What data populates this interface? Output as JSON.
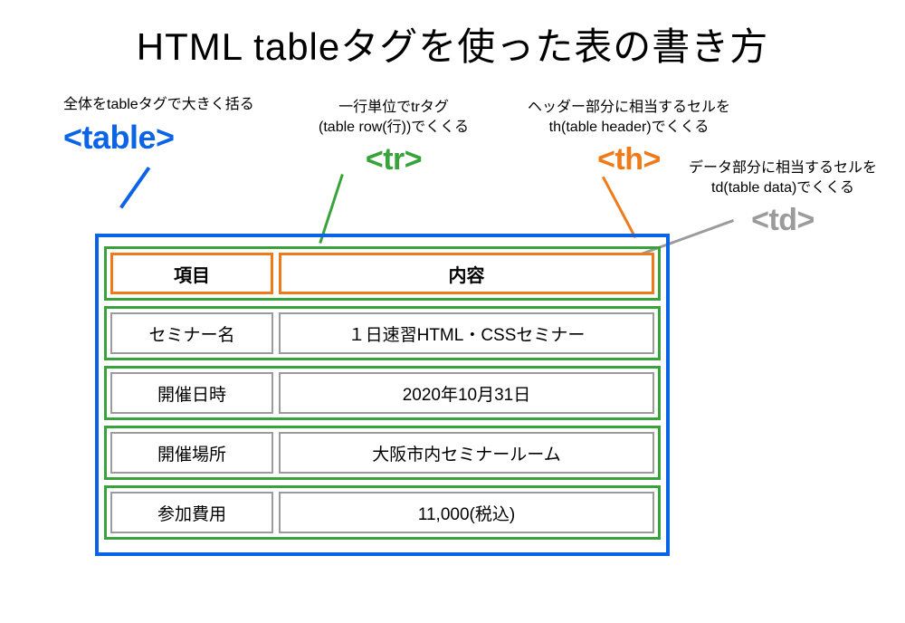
{
  "title": "HTML tableタグを使った表の書き方",
  "annotations": {
    "table": {
      "text": "全体をtableタグで大きく括る",
      "tag": "<table>"
    },
    "tr": {
      "text_line1": "一行単位でtrタグ",
      "text_line2": "(table row(行))でくくる",
      "tag": "<tr>"
    },
    "th": {
      "text_line1": "ヘッダー部分に相当するセルを",
      "text_line2": "th(table header)でくくる",
      "tag": "<th>"
    },
    "td": {
      "text_line1": "データ部分に相当するセルを",
      "text_line2": "td(table data)でくくる",
      "tag": "<td>"
    }
  },
  "tags": {
    "table_color": "#0b63e5",
    "tr_color": "#38a33a",
    "th_color": "#ef7a1a",
    "td_color": "#9b9b9b"
  },
  "table": {
    "headers": {
      "col1": "項目",
      "col2": "内容"
    },
    "rows": [
      {
        "label": "セミナー名",
        "value": "１日速習HTML・CSSセミナー"
      },
      {
        "label": "開催日時",
        "value": "2020年10月31日"
      },
      {
        "label": "開催場所",
        "value": "大阪市内セミナールーム"
      },
      {
        "label": "参加費用",
        "value": "11,000(税込)"
      }
    ]
  }
}
